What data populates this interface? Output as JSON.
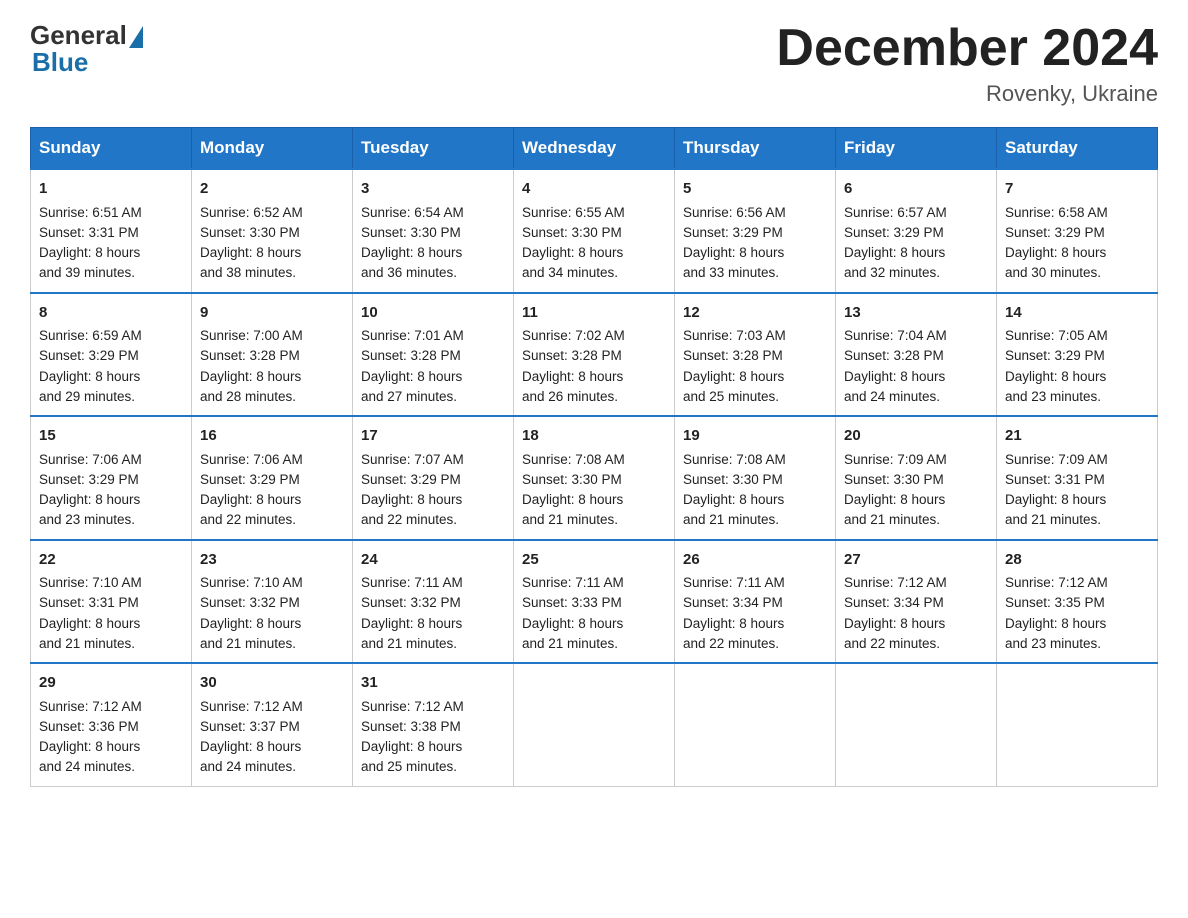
{
  "logo": {
    "general": "General",
    "blue": "Blue"
  },
  "title": "December 2024",
  "location": "Rovenky, Ukraine",
  "days_of_week": [
    "Sunday",
    "Monday",
    "Tuesday",
    "Wednesday",
    "Thursday",
    "Friday",
    "Saturday"
  ],
  "weeks": [
    [
      {
        "day": "1",
        "sunrise": "6:51 AM",
        "sunset": "3:31 PM",
        "daylight": "8 hours and 39 minutes."
      },
      {
        "day": "2",
        "sunrise": "6:52 AM",
        "sunset": "3:30 PM",
        "daylight": "8 hours and 38 minutes."
      },
      {
        "day": "3",
        "sunrise": "6:54 AM",
        "sunset": "3:30 PM",
        "daylight": "8 hours and 36 minutes."
      },
      {
        "day": "4",
        "sunrise": "6:55 AM",
        "sunset": "3:30 PM",
        "daylight": "8 hours and 34 minutes."
      },
      {
        "day": "5",
        "sunrise": "6:56 AM",
        "sunset": "3:29 PM",
        "daylight": "8 hours and 33 minutes."
      },
      {
        "day": "6",
        "sunrise": "6:57 AM",
        "sunset": "3:29 PM",
        "daylight": "8 hours and 32 minutes."
      },
      {
        "day": "7",
        "sunrise": "6:58 AM",
        "sunset": "3:29 PM",
        "daylight": "8 hours and 30 minutes."
      }
    ],
    [
      {
        "day": "8",
        "sunrise": "6:59 AM",
        "sunset": "3:29 PM",
        "daylight": "8 hours and 29 minutes."
      },
      {
        "day": "9",
        "sunrise": "7:00 AM",
        "sunset": "3:28 PM",
        "daylight": "8 hours and 28 minutes."
      },
      {
        "day": "10",
        "sunrise": "7:01 AM",
        "sunset": "3:28 PM",
        "daylight": "8 hours and 27 minutes."
      },
      {
        "day": "11",
        "sunrise": "7:02 AM",
        "sunset": "3:28 PM",
        "daylight": "8 hours and 26 minutes."
      },
      {
        "day": "12",
        "sunrise": "7:03 AM",
        "sunset": "3:28 PM",
        "daylight": "8 hours and 25 minutes."
      },
      {
        "day": "13",
        "sunrise": "7:04 AM",
        "sunset": "3:28 PM",
        "daylight": "8 hours and 24 minutes."
      },
      {
        "day": "14",
        "sunrise": "7:05 AM",
        "sunset": "3:29 PM",
        "daylight": "8 hours and 23 minutes."
      }
    ],
    [
      {
        "day": "15",
        "sunrise": "7:06 AM",
        "sunset": "3:29 PM",
        "daylight": "8 hours and 23 minutes."
      },
      {
        "day": "16",
        "sunrise": "7:06 AM",
        "sunset": "3:29 PM",
        "daylight": "8 hours and 22 minutes."
      },
      {
        "day": "17",
        "sunrise": "7:07 AM",
        "sunset": "3:29 PM",
        "daylight": "8 hours and 22 minutes."
      },
      {
        "day": "18",
        "sunrise": "7:08 AM",
        "sunset": "3:30 PM",
        "daylight": "8 hours and 21 minutes."
      },
      {
        "day": "19",
        "sunrise": "7:08 AM",
        "sunset": "3:30 PM",
        "daylight": "8 hours and 21 minutes."
      },
      {
        "day": "20",
        "sunrise": "7:09 AM",
        "sunset": "3:30 PM",
        "daylight": "8 hours and 21 minutes."
      },
      {
        "day": "21",
        "sunrise": "7:09 AM",
        "sunset": "3:31 PM",
        "daylight": "8 hours and 21 minutes."
      }
    ],
    [
      {
        "day": "22",
        "sunrise": "7:10 AM",
        "sunset": "3:31 PM",
        "daylight": "8 hours and 21 minutes."
      },
      {
        "day": "23",
        "sunrise": "7:10 AM",
        "sunset": "3:32 PM",
        "daylight": "8 hours and 21 minutes."
      },
      {
        "day": "24",
        "sunrise": "7:11 AM",
        "sunset": "3:32 PM",
        "daylight": "8 hours and 21 minutes."
      },
      {
        "day": "25",
        "sunrise": "7:11 AM",
        "sunset": "3:33 PM",
        "daylight": "8 hours and 21 minutes."
      },
      {
        "day": "26",
        "sunrise": "7:11 AM",
        "sunset": "3:34 PM",
        "daylight": "8 hours and 22 minutes."
      },
      {
        "day": "27",
        "sunrise": "7:12 AM",
        "sunset": "3:34 PM",
        "daylight": "8 hours and 22 minutes."
      },
      {
        "day": "28",
        "sunrise": "7:12 AM",
        "sunset": "3:35 PM",
        "daylight": "8 hours and 23 minutes."
      }
    ],
    [
      {
        "day": "29",
        "sunrise": "7:12 AM",
        "sunset": "3:36 PM",
        "daylight": "8 hours and 24 minutes."
      },
      {
        "day": "30",
        "sunrise": "7:12 AM",
        "sunset": "3:37 PM",
        "daylight": "8 hours and 24 minutes."
      },
      {
        "day": "31",
        "sunrise": "7:12 AM",
        "sunset": "3:38 PM",
        "daylight": "8 hours and 25 minutes."
      },
      null,
      null,
      null,
      null
    ]
  ],
  "labels": {
    "sunrise": "Sunrise:",
    "sunset": "Sunset:",
    "daylight": "Daylight:"
  }
}
